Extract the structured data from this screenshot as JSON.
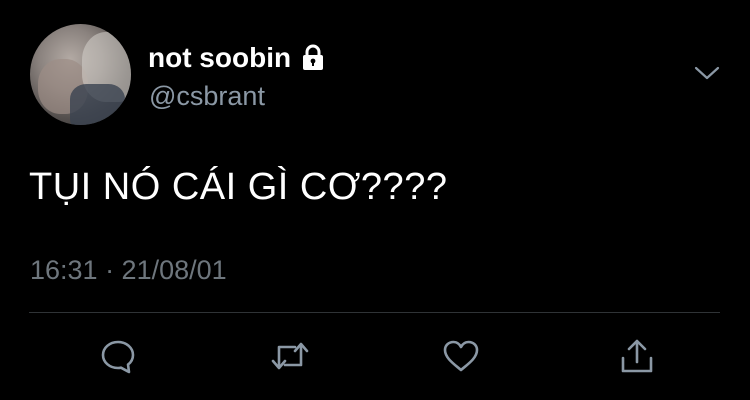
{
  "user": {
    "display_name": "not soobin",
    "handle": "@csbrant",
    "avatar": "profile-photo",
    "protected_icon": "lock-icon"
  },
  "tweet": {
    "text": "TỤI NÓ CÁI GÌ CƠ????",
    "timestamp": "16:31 · 21/08/01"
  },
  "actions": [
    {
      "name": "reply",
      "icon": "comment-icon"
    },
    {
      "name": "retweet",
      "icon": "retweet-icon"
    },
    {
      "name": "like",
      "icon": "heart-icon"
    },
    {
      "name": "share",
      "icon": "share-icon"
    }
  ],
  "menu": {
    "icon": "chevron-down-icon"
  },
  "colors": {
    "background": "#000000",
    "primary_text": "#ffffff",
    "secondary_text": "#8b98a5",
    "muted_text": "#6e767d",
    "divider": "#2f3336",
    "icon": "#8b98a5"
  }
}
